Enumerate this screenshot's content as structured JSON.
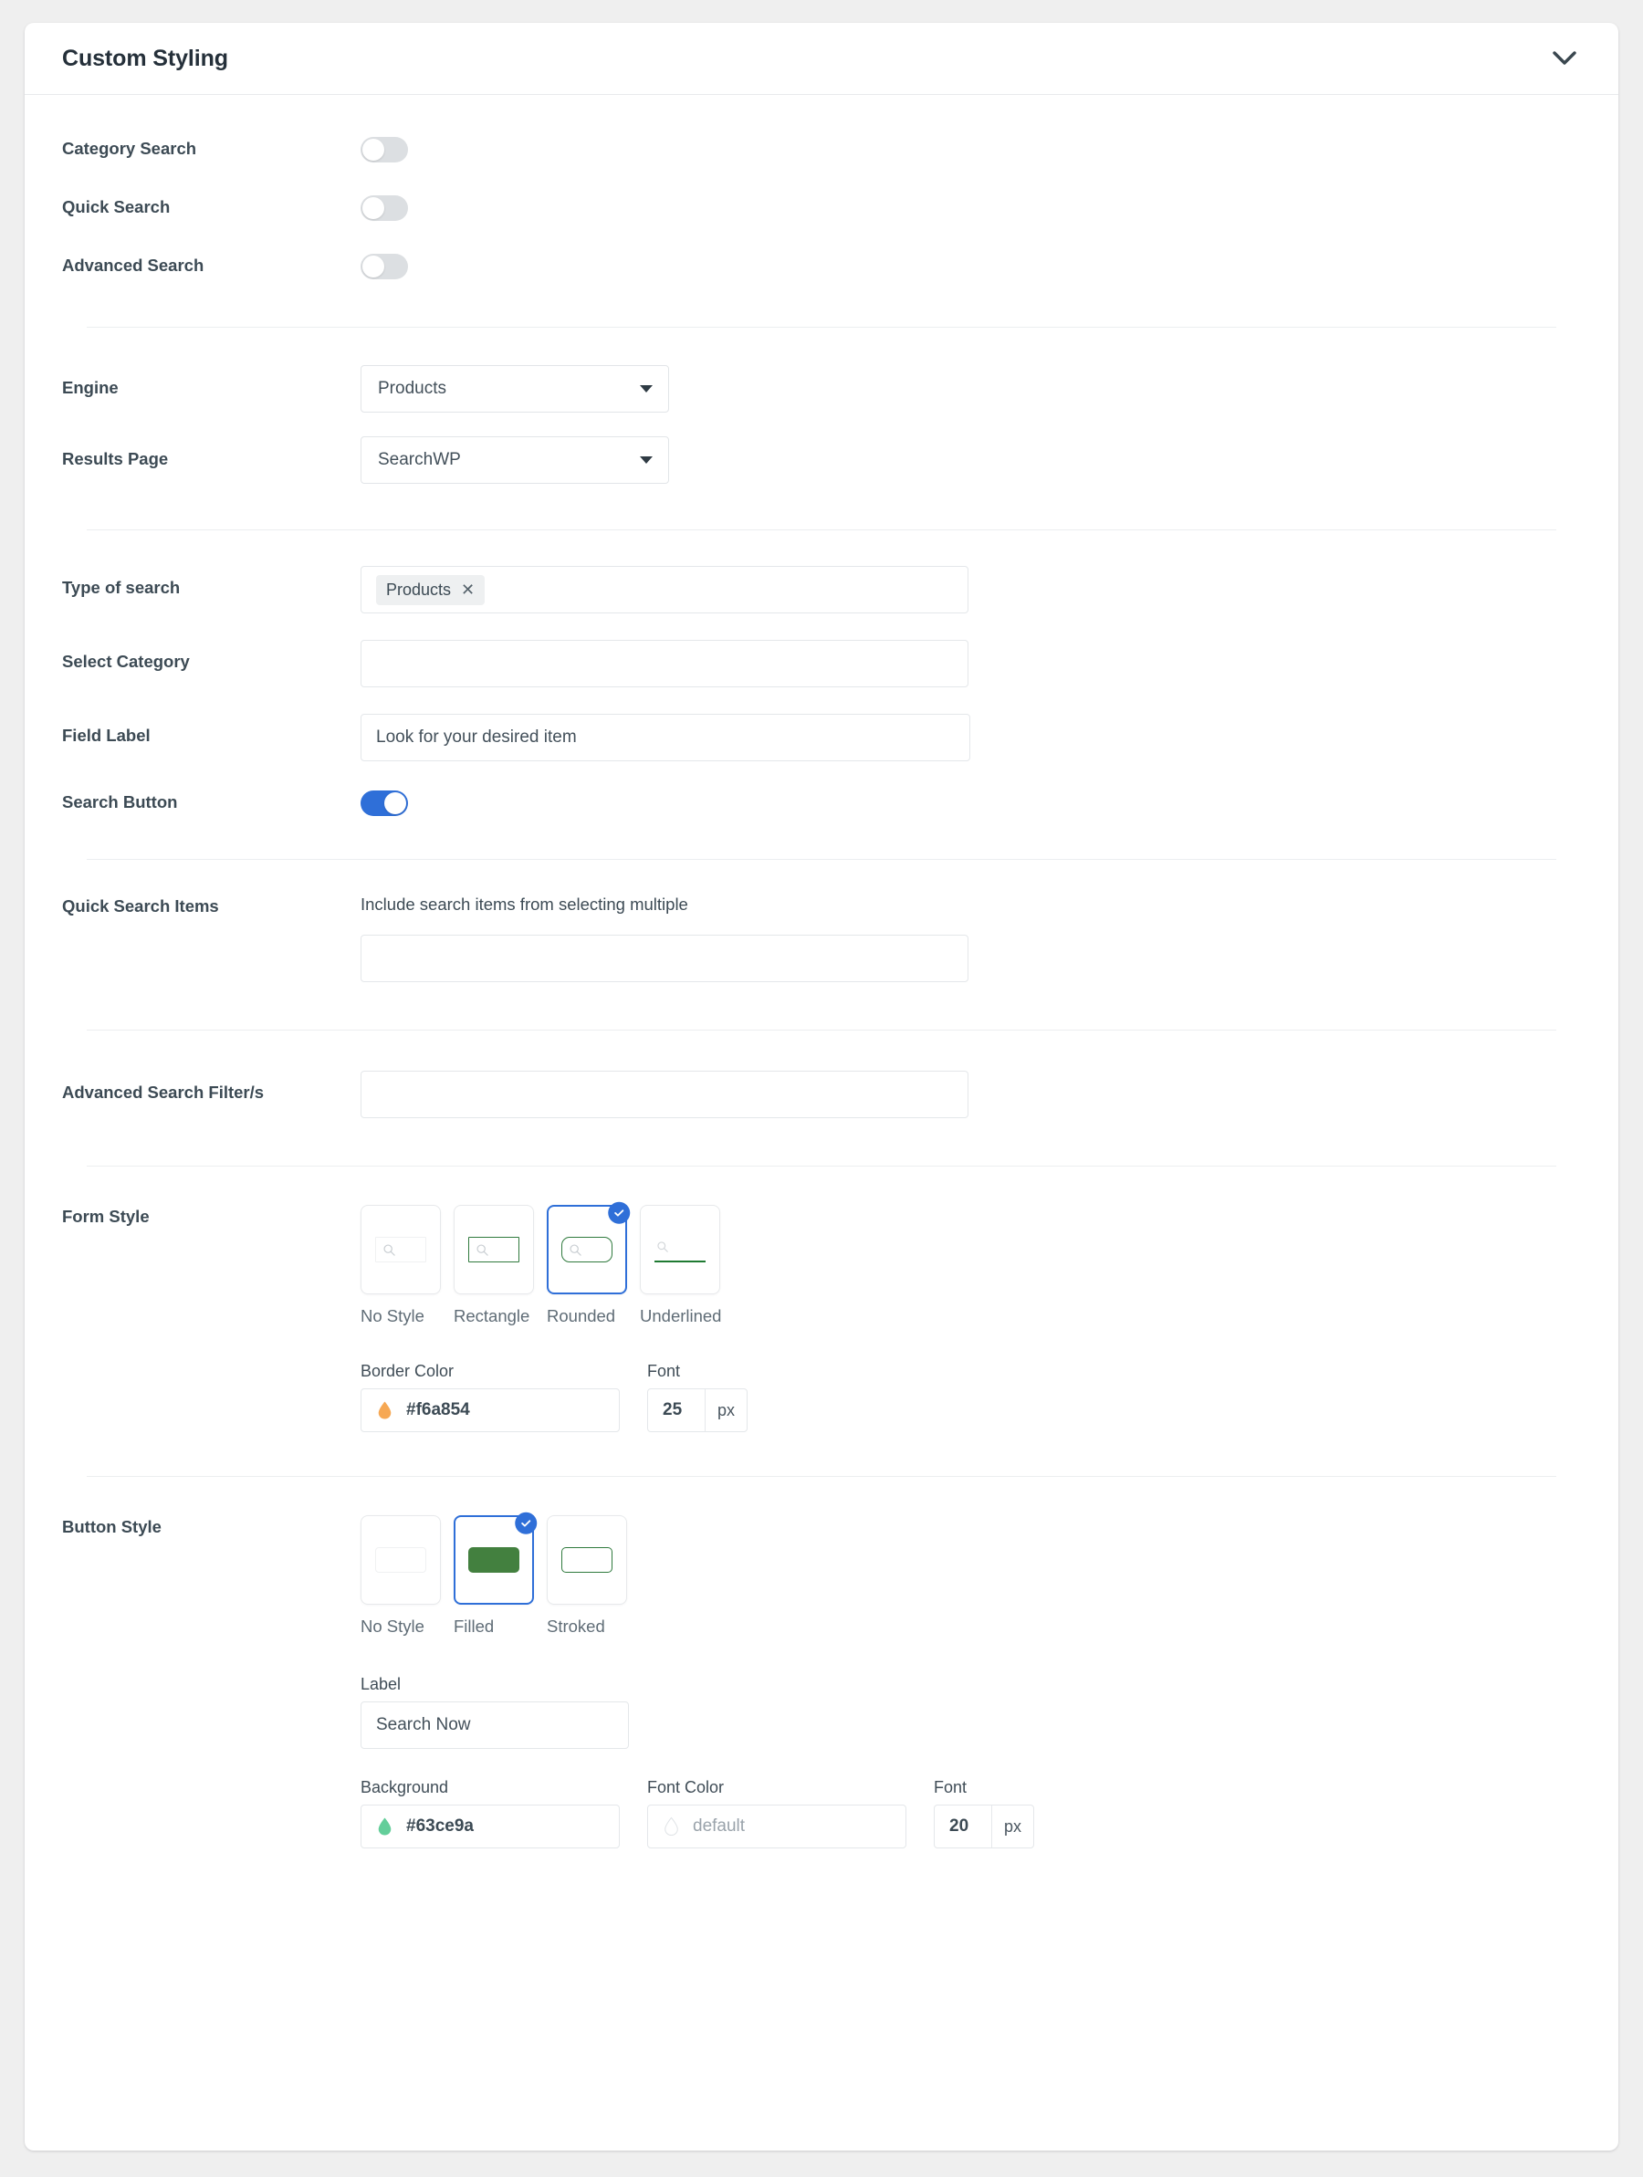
{
  "panel": {
    "title": "Custom Styling",
    "collapse_icon": "chevron-down-icon"
  },
  "toggles": [
    {
      "label": "Category Search",
      "state": "off"
    },
    {
      "label": "Quick Search",
      "state": "off"
    },
    {
      "label": "Advanced Search",
      "state": "off"
    }
  ],
  "selects": [
    {
      "label": "Engine",
      "value": "Products",
      "icon": "caret-down-icon"
    },
    {
      "label": "Results Page",
      "value": "SearchWP",
      "icon": "caret-down-icon"
    }
  ],
  "type_of_search": {
    "label": "Type of search",
    "chips": [
      {
        "text": "Products",
        "remove_icon": "close-icon"
      }
    ]
  },
  "select_category": {
    "label": "Select Category",
    "value": ""
  },
  "field_label": {
    "label": "Field Label",
    "value": "Look for your desired item"
  },
  "search_button": {
    "label": "Search Button",
    "state": "on"
  },
  "quick_search_items": {
    "label": "Quick Search Items",
    "helper": "Include search items from selecting multiple",
    "value": ""
  },
  "advanced_search_filters": {
    "label": "Advanced Search Filter/s",
    "value": ""
  },
  "form_style": {
    "label": "Form Style",
    "options": [
      {
        "name": "No Style",
        "selected": false,
        "preview": "input-plain"
      },
      {
        "name": "Rectangle",
        "selected": false,
        "preview": "input-rectangle"
      },
      {
        "name": "Rounded",
        "selected": true,
        "preview": "input-rounded"
      },
      {
        "name": "Underlined",
        "selected": false,
        "preview": "input-underlined"
      }
    ],
    "border_color": {
      "label": "Border Color",
      "value": "#f6a854",
      "swatch": "#f6a854",
      "icon": "color-drop-icon"
    },
    "font": {
      "label": "Font",
      "value": "25",
      "unit": "px"
    }
  },
  "button_style": {
    "label": "Button Style",
    "options": [
      {
        "name": "No Style",
        "selected": false,
        "preview": "button-plain"
      },
      {
        "name": "Filled",
        "selected": true,
        "preview": "button-filled"
      },
      {
        "name": "Stroked",
        "selected": false,
        "preview": "button-stroked"
      }
    ],
    "button_label": {
      "label": "Label",
      "value": "Search Now"
    },
    "background": {
      "label": "Background",
      "value": "#63ce9a",
      "swatch": "#63ce9a",
      "icon": "color-drop-icon"
    },
    "font_color": {
      "label": "Font Color",
      "value": "",
      "placeholder": "default",
      "swatch": "none",
      "icon": "color-drop-icon"
    },
    "font": {
      "label": "Font",
      "value": "20",
      "unit": "px"
    }
  },
  "colors": {
    "accent_blue": "#2f6fd8",
    "preview_green": "#2f7a3d",
    "filled_green": "#43803f",
    "panel_bg": "#ffffff",
    "page_bg": "#efefef"
  }
}
